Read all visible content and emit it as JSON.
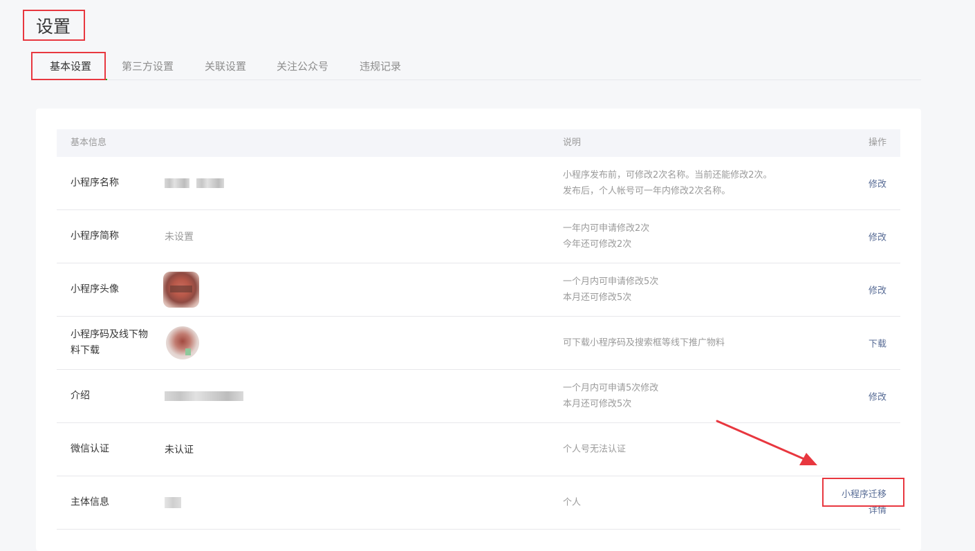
{
  "page": {
    "title": "设置"
  },
  "tabs": [
    {
      "label": "基本设置",
      "active": true
    },
    {
      "label": "第三方设置",
      "active": false
    },
    {
      "label": "关联设置",
      "active": false
    },
    {
      "label": "关注公众号",
      "active": false
    },
    {
      "label": "违规记录",
      "active": false
    }
  ],
  "table": {
    "headers": {
      "info": "基本信息",
      "desc": "说明",
      "action": "操作"
    },
    "rows": [
      {
        "label": "小程序名称",
        "value": "",
        "desc": [
          "小程序发布前，可修改2次名称。当前还能修改2次。",
          "发布后，个人帐号可一年内修改2次名称。"
        ],
        "action": "修改"
      },
      {
        "label": "小程序简称",
        "value": "未设置",
        "desc": [
          "一年内可申请修改2次",
          "今年还可修改2次"
        ],
        "action": "修改"
      },
      {
        "label": "小程序头像",
        "value": "",
        "desc": [
          "一个月内可申请修改5次",
          "本月还可修改5次"
        ],
        "action": "修改"
      },
      {
        "label": "小程序码及线下物料下载",
        "value": "",
        "desc": [
          "可下载小程序码及搜索框等线下推广物料"
        ],
        "action": "下载"
      },
      {
        "label": "介绍",
        "value": "",
        "desc": [
          "一个月内可申请5次修改",
          "本月还可修改5次"
        ],
        "action": "修改"
      },
      {
        "label": "微信认证",
        "value": "未认证",
        "desc": [
          "个人号无法认证"
        ],
        "action": ""
      },
      {
        "label": "主体信息",
        "value": "",
        "desc": [
          "个人"
        ],
        "actions": [
          "小程序迁移",
          "详情"
        ]
      }
    ]
  },
  "colors": {
    "accent_green": "#1aad19",
    "link": "#576b95",
    "annotation_red": "#e8373f",
    "page_bg": "#f6f7f9"
  }
}
